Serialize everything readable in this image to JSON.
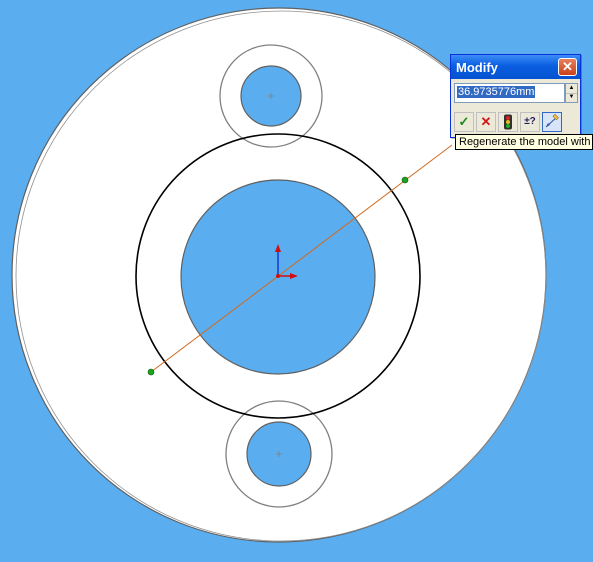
{
  "colors": {
    "background": "#5aaef0",
    "part_face": "#ffffff",
    "dimension_line": "#d2691e",
    "sketch_circle": "#000000",
    "edge": "#707070",
    "endpoint": "#20a020"
  },
  "modify_dialog": {
    "title": "Modify",
    "close_icon": "close-icon",
    "value": "36.9735776mm",
    "buttons": [
      {
        "name": "accept",
        "icon": "checkmark-icon",
        "glyph": "✓"
      },
      {
        "name": "cancel",
        "icon": "x-icon",
        "glyph": "✕"
      },
      {
        "name": "rebuild",
        "icon": "traffic-light-icon",
        "glyph": ""
      },
      {
        "name": "tolerance",
        "icon": "plus-minus-question-icon",
        "glyph": "±?"
      },
      {
        "name": "mark-dimension",
        "icon": "dimension-pencil-icon",
        "glyph": ""
      }
    ]
  },
  "tooltip": {
    "text": "Regenerate the model with t"
  }
}
